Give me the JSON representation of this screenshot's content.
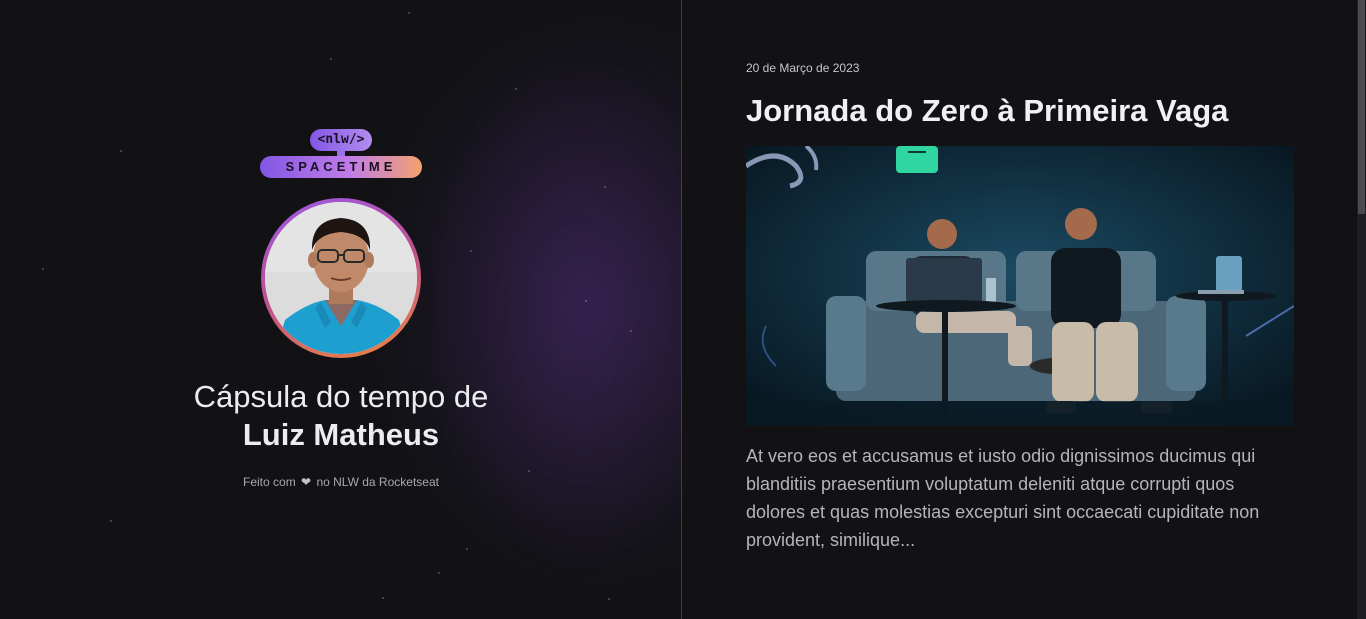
{
  "brand": {
    "tag": "<nlw/>",
    "name": "SPACETIME"
  },
  "profile": {
    "headline": "Cápsula do tempo de",
    "name": "Luiz Matheus",
    "avatar_alt": "avatar"
  },
  "footer": {
    "prefix": "Feito com",
    "icon": "heart-icon",
    "suffix": "no NLW da Rocketseat"
  },
  "memories": [
    {
      "date": "20 de Março de 2023",
      "title": "Jornada do Zero à Primeira Vaga",
      "excerpt": "At vero eos et accusamus et iusto odio dignissimos ducimus qui blanditiis praesentium voluptatum deleniti atque corrupti quos dolores et quas molestias excepturi sint occaecati cupiditate non provident, similique..."
    }
  ],
  "colors": {
    "background": "#121215",
    "divider": "#3d3d45",
    "brand_purple": "#8257e5",
    "brand_orange": "#f3a16e"
  }
}
